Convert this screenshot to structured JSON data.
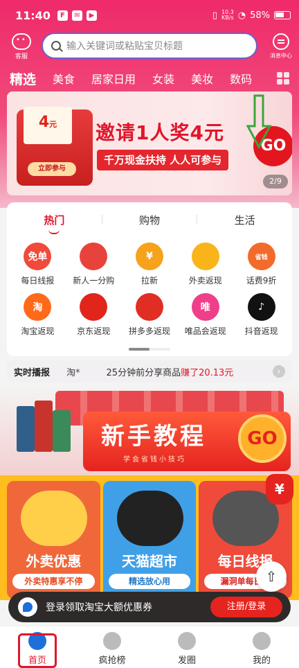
{
  "status": {
    "time": "11:40",
    "net_speed_top": "10.3",
    "net_speed_bottom": "KB/s",
    "battery": "58%"
  },
  "header": {
    "kefu_label": "客服",
    "search_placeholder": "输入关键词或粘贴宝贝标题",
    "message_label": "消息中心"
  },
  "categories": [
    "精选",
    "美食",
    "居家日用",
    "女装",
    "美妆",
    "数码"
  ],
  "banner": {
    "amount": "4",
    "amount_unit": "元",
    "join_label": "立即参与",
    "title": "邀请1人奖4元",
    "subtitle": "千万现金扶持 人人可参与",
    "go": "GO",
    "page_indicator": "2/9"
  },
  "panel": {
    "tabs": [
      "热门",
      "购物",
      "生活"
    ],
    "icons": [
      {
        "label": "每日线报",
        "badge": "免单",
        "color": "#f04a3b"
      },
      {
        "label": "新人一分购",
        "badge": "",
        "color": "#e8433a"
      },
      {
        "label": "拉新",
        "badge": "¥",
        "color": "#f7a21b"
      },
      {
        "label": "外卖返现",
        "badge": "",
        "color": "#f9b41a"
      },
      {
        "label": "话费9折",
        "badge": "省钱",
        "color": "#f36b2b"
      },
      {
        "label": "淘宝返现",
        "badge": "淘",
        "color": "#ff6a1a"
      },
      {
        "label": "京东返现",
        "badge": "",
        "color": "#e1251b"
      },
      {
        "label": "拼多多返现",
        "badge": "",
        "color": "#e02e24"
      },
      {
        "label": "唯品会返现",
        "badge": "唯",
        "color": "#f03f8a"
      },
      {
        "label": "抖音返现",
        "badge": "♪",
        "color": "#111111"
      }
    ]
  },
  "news": {
    "label": "实时播报",
    "user": "淘*",
    "text": "25分钟前分享商品",
    "amount": "赚了20.13元"
  },
  "tutorial": {
    "title": "新手教程",
    "subtitle": "学会省钱小技巧",
    "go": "GO"
  },
  "promos": [
    {
      "title": "外卖优惠",
      "sub": "外卖特惠享不停",
      "color": "#f0683a",
      "sub_color": "#e84a1f"
    },
    {
      "title": "天猫超市",
      "sub": "精选放心用",
      "color": "#3fa0e8",
      "sub_color": "#1f78c8"
    },
    {
      "title": "每日线报",
      "sub": "漏洞单每日更",
      "color": "#f04a3b",
      "sub_color": "#d8231f"
    }
  ],
  "promo_badge": "¥",
  "login": {
    "text": "登录领取淘宝大额优惠券",
    "button": "注册/登录"
  },
  "tabbar": [
    "首页",
    "疯抢榜",
    "发圈",
    "我的"
  ]
}
